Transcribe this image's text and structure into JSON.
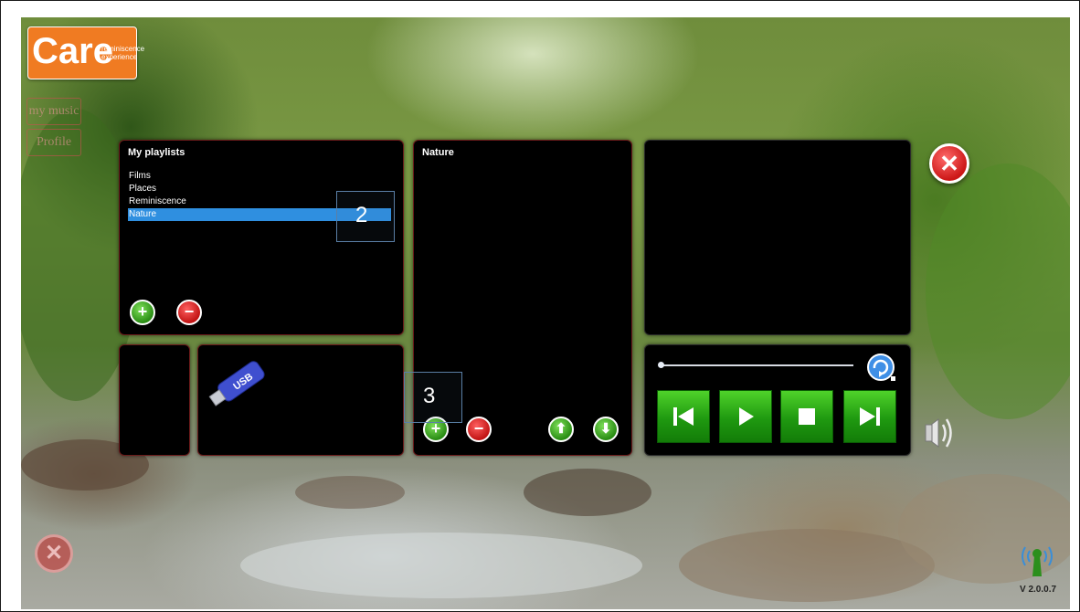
{
  "logo": {
    "big": "Care",
    "sub": "reminiscence experience"
  },
  "sidebar": {
    "my_music": "my music",
    "profile": "Profile"
  },
  "playlists_panel": {
    "title": "My playlists",
    "items": [
      "Films",
      "Places",
      "Reminiscence",
      "Nature"
    ],
    "selected_index": 3
  },
  "playlist_contents": {
    "title": "Nature",
    "items": []
  },
  "usb": {
    "label": "USB"
  },
  "annotations": {
    "box2": "2",
    "box3": "3"
  },
  "player": {
    "seek_progress": 0,
    "buttons": [
      "skip-back",
      "play",
      "stop",
      "skip-forward"
    ]
  },
  "footer": {
    "version": "V 2.0.0.7"
  },
  "colors": {
    "accent_orange": "#f07b22",
    "selection_blue": "#2f8fe0",
    "control_green": "#1f9910",
    "delete_red": "#cc1717"
  }
}
